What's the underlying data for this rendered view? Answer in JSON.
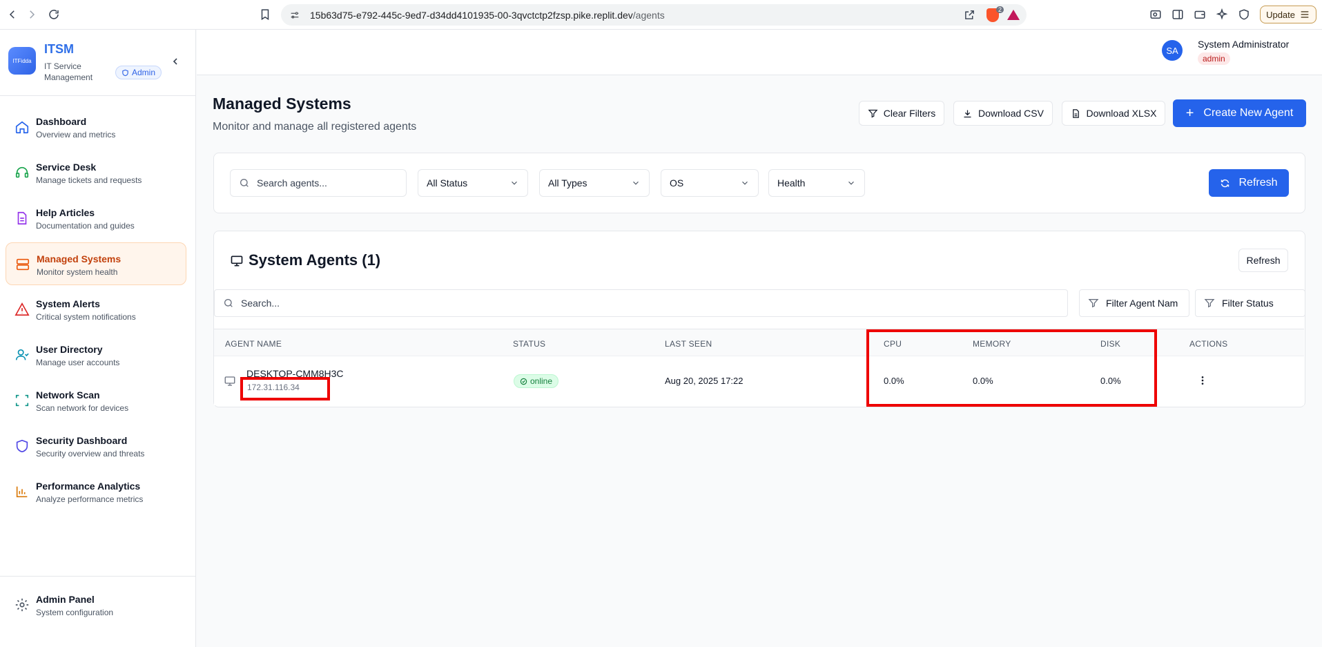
{
  "browser": {
    "url_host": "15b63d75-e792-445c-9ed7-d34dd4101935-00-3qvctctp2fzsp.pike.replit.dev",
    "url_path": "/agents",
    "shield_badge": "2",
    "update_label": "Update"
  },
  "sidebar": {
    "logo_text": "ITFidda",
    "brand_title": "ITSM",
    "brand_sub": "IT Service Management",
    "admin_badge": "Admin",
    "items": [
      {
        "label": "Dashboard",
        "desc": "Overview and metrics",
        "icon": "home-icon"
      },
      {
        "label": "Service Desk",
        "desc": "Manage tickets and requests",
        "icon": "headset-icon"
      },
      {
        "label": "Help Articles",
        "desc": "Documentation and guides",
        "icon": "document-icon"
      },
      {
        "label": "Managed Systems",
        "desc": "Monitor system health",
        "icon": "server-icon"
      },
      {
        "label": "System Alerts",
        "desc": "Critical system notifications",
        "icon": "alert-triangle-icon"
      },
      {
        "label": "User Directory",
        "desc": "Manage user accounts",
        "icon": "users-icon"
      },
      {
        "label": "Network Scan",
        "desc": "Scan network for devices",
        "icon": "scan-icon"
      },
      {
        "label": "Security Dashboard",
        "desc": "Security overview and threats",
        "icon": "shield-icon"
      },
      {
        "label": "Performance Analytics",
        "desc": "Analyze performance metrics",
        "icon": "bar-chart-icon"
      }
    ],
    "admin_panel": {
      "label": "Admin Panel",
      "desc": "System configuration"
    }
  },
  "header": {
    "avatar": "SA",
    "user_name": "System Administrator",
    "user_role": "admin"
  },
  "main": {
    "title": "Managed Systems",
    "subtitle": "Monitor and manage all registered agents",
    "clear_filters": "Clear Filters",
    "download_csv": "Download CSV",
    "download_xlsx": "Download XLSX",
    "create_agent": "Create New Agent",
    "filters": {
      "search_placeholder": "Search agents...",
      "status": "All Status",
      "types": "All Types",
      "os": "OS",
      "health": "Health",
      "refresh": "Refresh"
    },
    "agents": {
      "title": "System Agents (1)",
      "refresh": "Refresh",
      "search_placeholder": "Search...",
      "filter_agent_name": "Filter Agent Nam",
      "filter_status": "Filter Status",
      "columns": [
        "AGENT NAME",
        "STATUS",
        "LAST SEEN",
        "CPU",
        "MEMORY",
        "DISK",
        "ACTIONS"
      ],
      "rows": [
        {
          "name": "DESKTOP-CMM8H3C",
          "ip": "172.31.116.34",
          "status": "online",
          "last_seen": "Aug 20, 2025 17:22",
          "cpu": "0.0%",
          "memory": "0.0%",
          "disk": "0.0%"
        }
      ]
    }
  }
}
